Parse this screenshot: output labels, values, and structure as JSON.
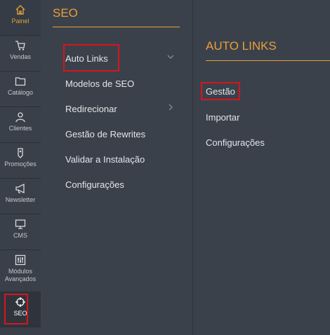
{
  "rail": {
    "items": [
      {
        "label": "Painel",
        "icon": "home-icon"
      },
      {
        "label": "Vendas",
        "icon": "cart-icon"
      },
      {
        "label": "Catálogo",
        "icon": "folder-icon"
      },
      {
        "label": "Clientes",
        "icon": "person-icon"
      },
      {
        "label": "Promoções",
        "icon": "tag-icon"
      },
      {
        "label": "Newsletter",
        "icon": "megaphone-icon"
      },
      {
        "label": "CMS",
        "icon": "monitor-icon"
      },
      {
        "label": "Módulos Avançados",
        "icon": "sliders-icon"
      },
      {
        "label": "SEO",
        "icon": "crosshair-icon"
      }
    ]
  },
  "seo_menu": {
    "title": "SEO",
    "items": [
      {
        "label": "Auto Links"
      },
      {
        "label": "Modelos de SEO"
      },
      {
        "label": "Redirecionar"
      },
      {
        "label": "Gestão de Rewrites"
      },
      {
        "label": "Validar a Instalação"
      },
      {
        "label": "Configurações"
      }
    ]
  },
  "auto_links_menu": {
    "title": "AUTO LINKS",
    "items": [
      {
        "label": "Gestão"
      },
      {
        "label": "Importar"
      },
      {
        "label": "Configurações"
      }
    ]
  },
  "colors": {
    "accent": "#e7a03a",
    "highlight_border": "#d8141d",
    "background": "#3b414b"
  }
}
